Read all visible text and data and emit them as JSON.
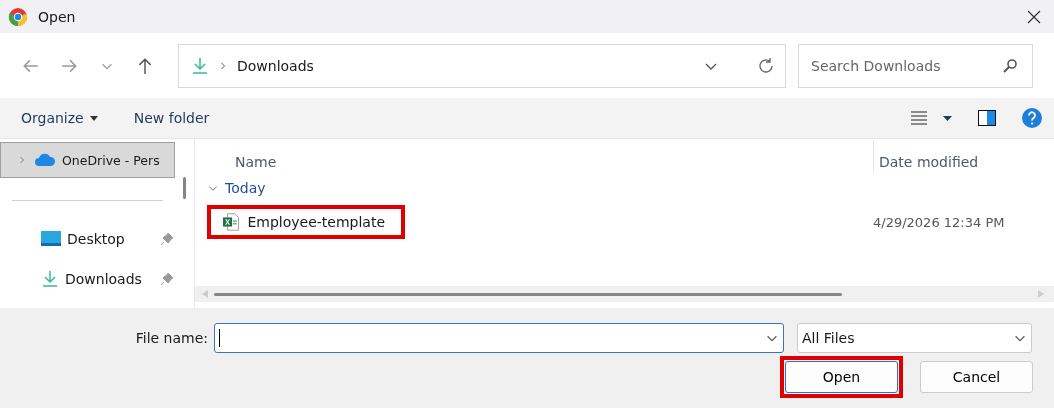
{
  "window": {
    "title": "Open"
  },
  "navigation": {
    "path": "Downloads",
    "search_placeholder": "Search Downloads"
  },
  "command_bar": {
    "buttons": [
      {
        "label": "Organize",
        "kind": "menu"
      },
      {
        "label": "New folder",
        "kind": "plain"
      }
    ]
  },
  "sidebar": {
    "items": [
      {
        "label": "OneDrive - Pers",
        "kind": "cloud",
        "selected": true,
        "pinned": false
      },
      {
        "kind": "divider"
      },
      {
        "label": "Desktop",
        "kind": "desktop",
        "selected": false,
        "pinned": true
      },
      {
        "label": "Downloads",
        "kind": "download",
        "selected": false,
        "pinned": true
      }
    ]
  },
  "file_list": {
    "columns": [
      "Name",
      "Date modified"
    ],
    "groups": [
      {
        "label": "Today",
        "expanded": true,
        "files": [
          {
            "name": "Employee-template",
            "date_modified": "4/29/2026 12:34 PM",
            "highlighted": true
          }
        ]
      }
    ]
  },
  "footer": {
    "file_name_label": "File name:",
    "file_type": "All Files",
    "buttons": [
      {
        "label": "Open",
        "kind": "primary",
        "highlighted": true
      },
      {
        "label": "Cancel",
        "kind": "secondary",
        "highlighted": false
      }
    ]
  }
}
